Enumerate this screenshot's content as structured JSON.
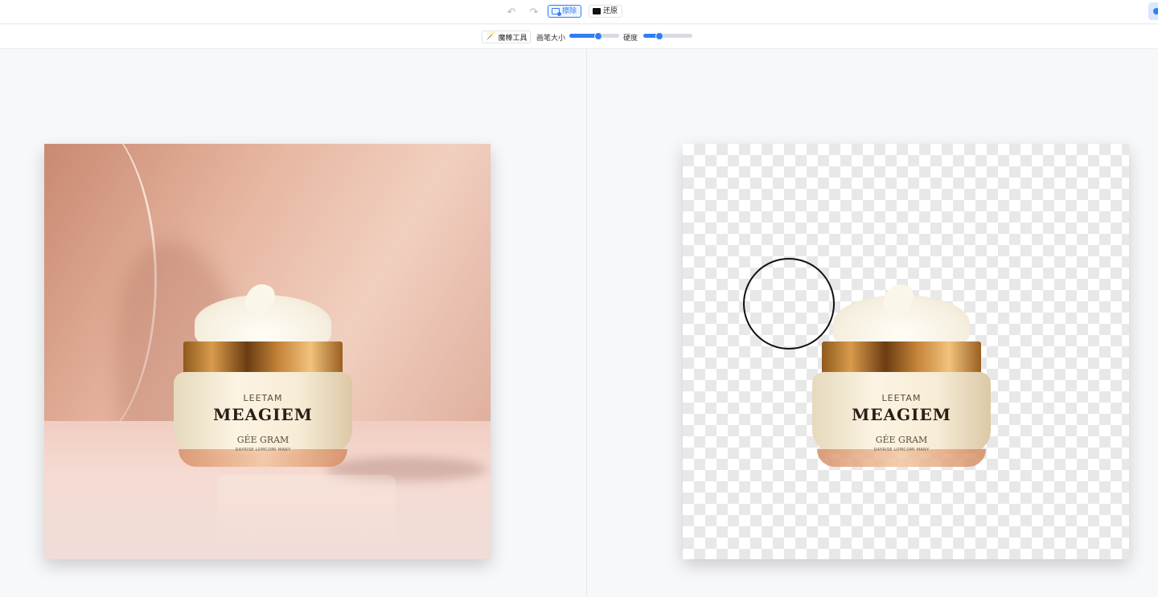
{
  "topbar": {
    "undo_icon": "undo-icon",
    "redo_icon": "redo-icon",
    "erase_label": "擦除",
    "restore_label": "还原"
  },
  "toolbar": {
    "magic_wand_label": "魔棒工具",
    "brush_size_label": "画笔大小",
    "brush_size_value_fraction": 0.58,
    "hardness_label": "硬度",
    "hardness_value_fraction": 0.32
  },
  "product": {
    "line1": "LEETAM",
    "line2": "MEAGIEM",
    "line3": "GÉE GRAM",
    "line4": "DAYRISE LOMCOMI MANY"
  },
  "colors": {
    "accent": "#2f7ef5"
  }
}
